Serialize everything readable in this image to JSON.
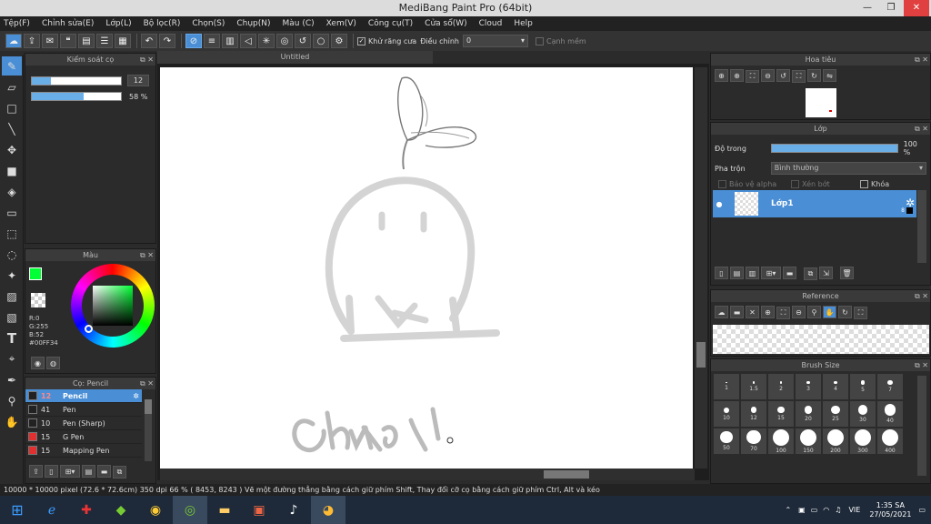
{
  "window": {
    "title": "MediBang Paint Pro (64bit)"
  },
  "menu": [
    "Tệp(F)",
    "Chỉnh sửa(E)",
    "Lớp(L)",
    "Bộ lọc(R)",
    "Chọn(S)",
    "Chụp(N)",
    "Màu (C)",
    "Xem(V)",
    "Công cụ(T)",
    "Cửa sổ(W)",
    "Cloud",
    "Help"
  ],
  "toolbar": {
    "antialias_label": "Khử răng cưa",
    "adjust_label": "Điều chỉnh",
    "adjust_value": "0",
    "snap_label": "Cạnh mềm"
  },
  "brush_control": {
    "title": "Kiểm soát cọ",
    "size": "12",
    "opacity": "58 %",
    "size_fraction": 0.12,
    "opacity_fraction": 0.58
  },
  "color_panel": {
    "title": "Màu",
    "r": "R:0",
    "g": "G:255",
    "b": "B:52",
    "hex": "#00FF34",
    "primary": "#00ff34"
  },
  "brush_panel": {
    "title": "Cọ: Pencil",
    "items": [
      {
        "size": "12",
        "name": "Pencil",
        "color": "#222222"
      },
      {
        "size": "41",
        "name": "Pen",
        "color": "#222222"
      },
      {
        "size": "10",
        "name": "Pen (Sharp)",
        "color": "#222222"
      },
      {
        "size": "15",
        "name": "G Pen",
        "color": "#e03030"
      },
      {
        "size": "15",
        "name": "Mapping Pen",
        "color": "#e03030"
      }
    ]
  },
  "document": {
    "tab": "Untitled"
  },
  "navigator": {
    "title": "Hoa tiêu"
  },
  "layer_panel": {
    "title": "Lớp",
    "opacity_label": "Độ trong",
    "opacity_value": "100 %",
    "opacity_fraction": 1.0,
    "blend_label": "Pha trộn",
    "blend_value": "Bình thường",
    "protect_alpha": "Bảo vệ alpha",
    "clipping": "Xén bớt",
    "lock": "Khóa",
    "layer_name": "Lớp1",
    "layer_num": "8"
  },
  "reference": {
    "title": "Reference"
  },
  "brush_size": {
    "title": "Brush Size",
    "sizes": [
      "1",
      "1.5",
      "2",
      "3",
      "4",
      "5",
      "7",
      "10",
      "12",
      "15",
      "20",
      "25",
      "30",
      "40",
      "50",
      "70",
      "100",
      "150",
      "200",
      "300",
      "400"
    ]
  },
  "status": "10000 * 10000 pixel   (72.6 * 72.6cm)   350 dpi   66 %   ( 8453, 8243 )   Vẽ một đường thẳng bằng cách giữ phím Shift, Thay đổi cỡ cọ bằng cách giữ phím Ctrl, Alt và kéo",
  "taskbar": {
    "time": "1:35 SA",
    "date": "27/05/2021",
    "lang": "VIE"
  }
}
